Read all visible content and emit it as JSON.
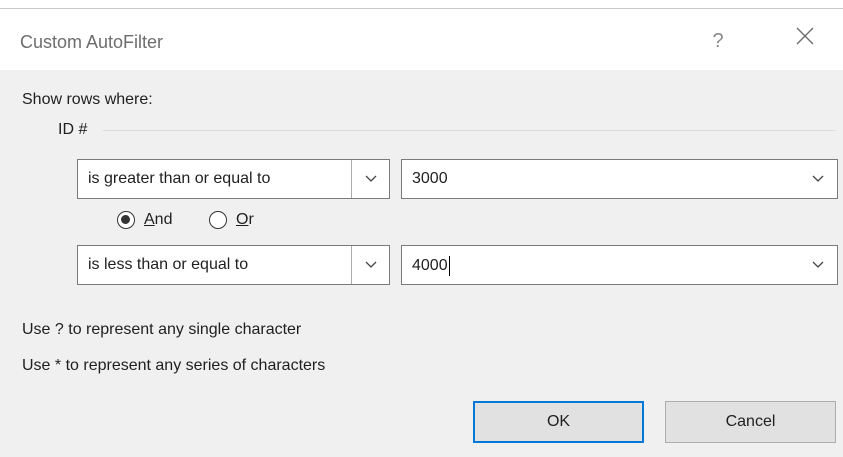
{
  "dialog": {
    "title": "Custom AutoFilter",
    "help_glyph": "?",
    "show_rows_label": "Show rows where:",
    "field_label": "ID #"
  },
  "criteria": [
    {
      "operator": "is greater than or equal to",
      "value": "3000"
    },
    {
      "operator": "is less than or equal to",
      "value": "4000"
    }
  ],
  "logic": {
    "and_prefix": "",
    "and_accel": "A",
    "and_rest": "nd",
    "or_accel": "O",
    "or_rest": "r",
    "selected": "And"
  },
  "hints": {
    "single": "Use ? to represent any single character",
    "series": "Use * to represent any series of characters"
  },
  "buttons": {
    "ok": "OK",
    "cancel": "Cancel"
  },
  "colors": {
    "default_button_border": "#0078d7",
    "dialog_background": "#f0f0f0"
  }
}
